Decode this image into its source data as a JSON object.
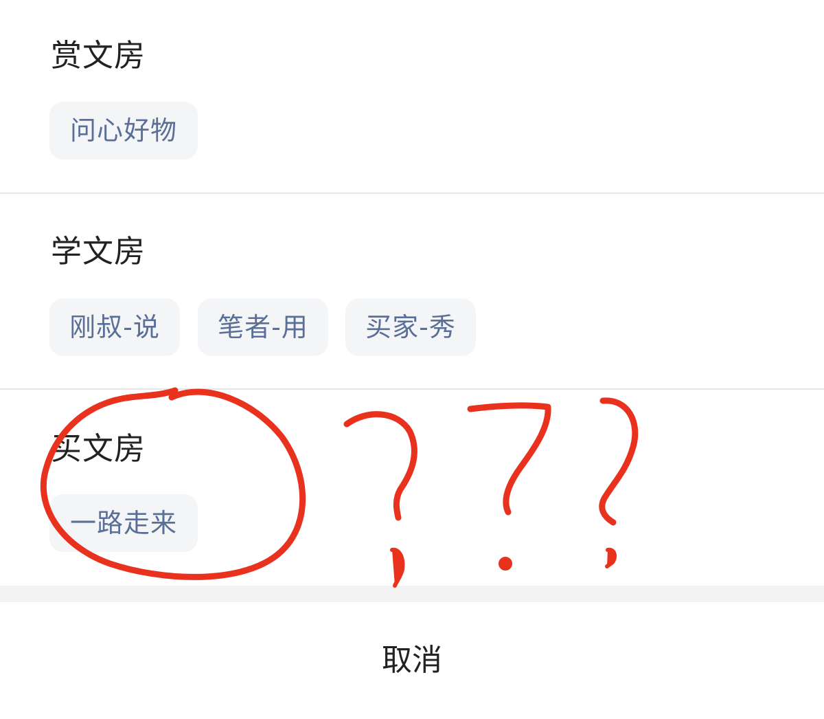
{
  "sections": [
    {
      "title": "赏文房",
      "chips": [
        "问心好物"
      ]
    },
    {
      "title": "学文房",
      "chips": [
        "刚叔-说",
        "笔者-用",
        "买家-秀"
      ]
    },
    {
      "title": "买文房",
      "chips": [
        "一路走来"
      ]
    }
  ],
  "cancel_label": "取消",
  "colors": {
    "chip_text": "#5a6f97",
    "chip_bg": "#f4f5f7",
    "annotation": "#e8321e"
  },
  "annotation": {
    "icons": [
      "circle-scribble-icon",
      "question-mark-icon",
      "question-mark-icon",
      "question-mark-icon"
    ]
  }
}
